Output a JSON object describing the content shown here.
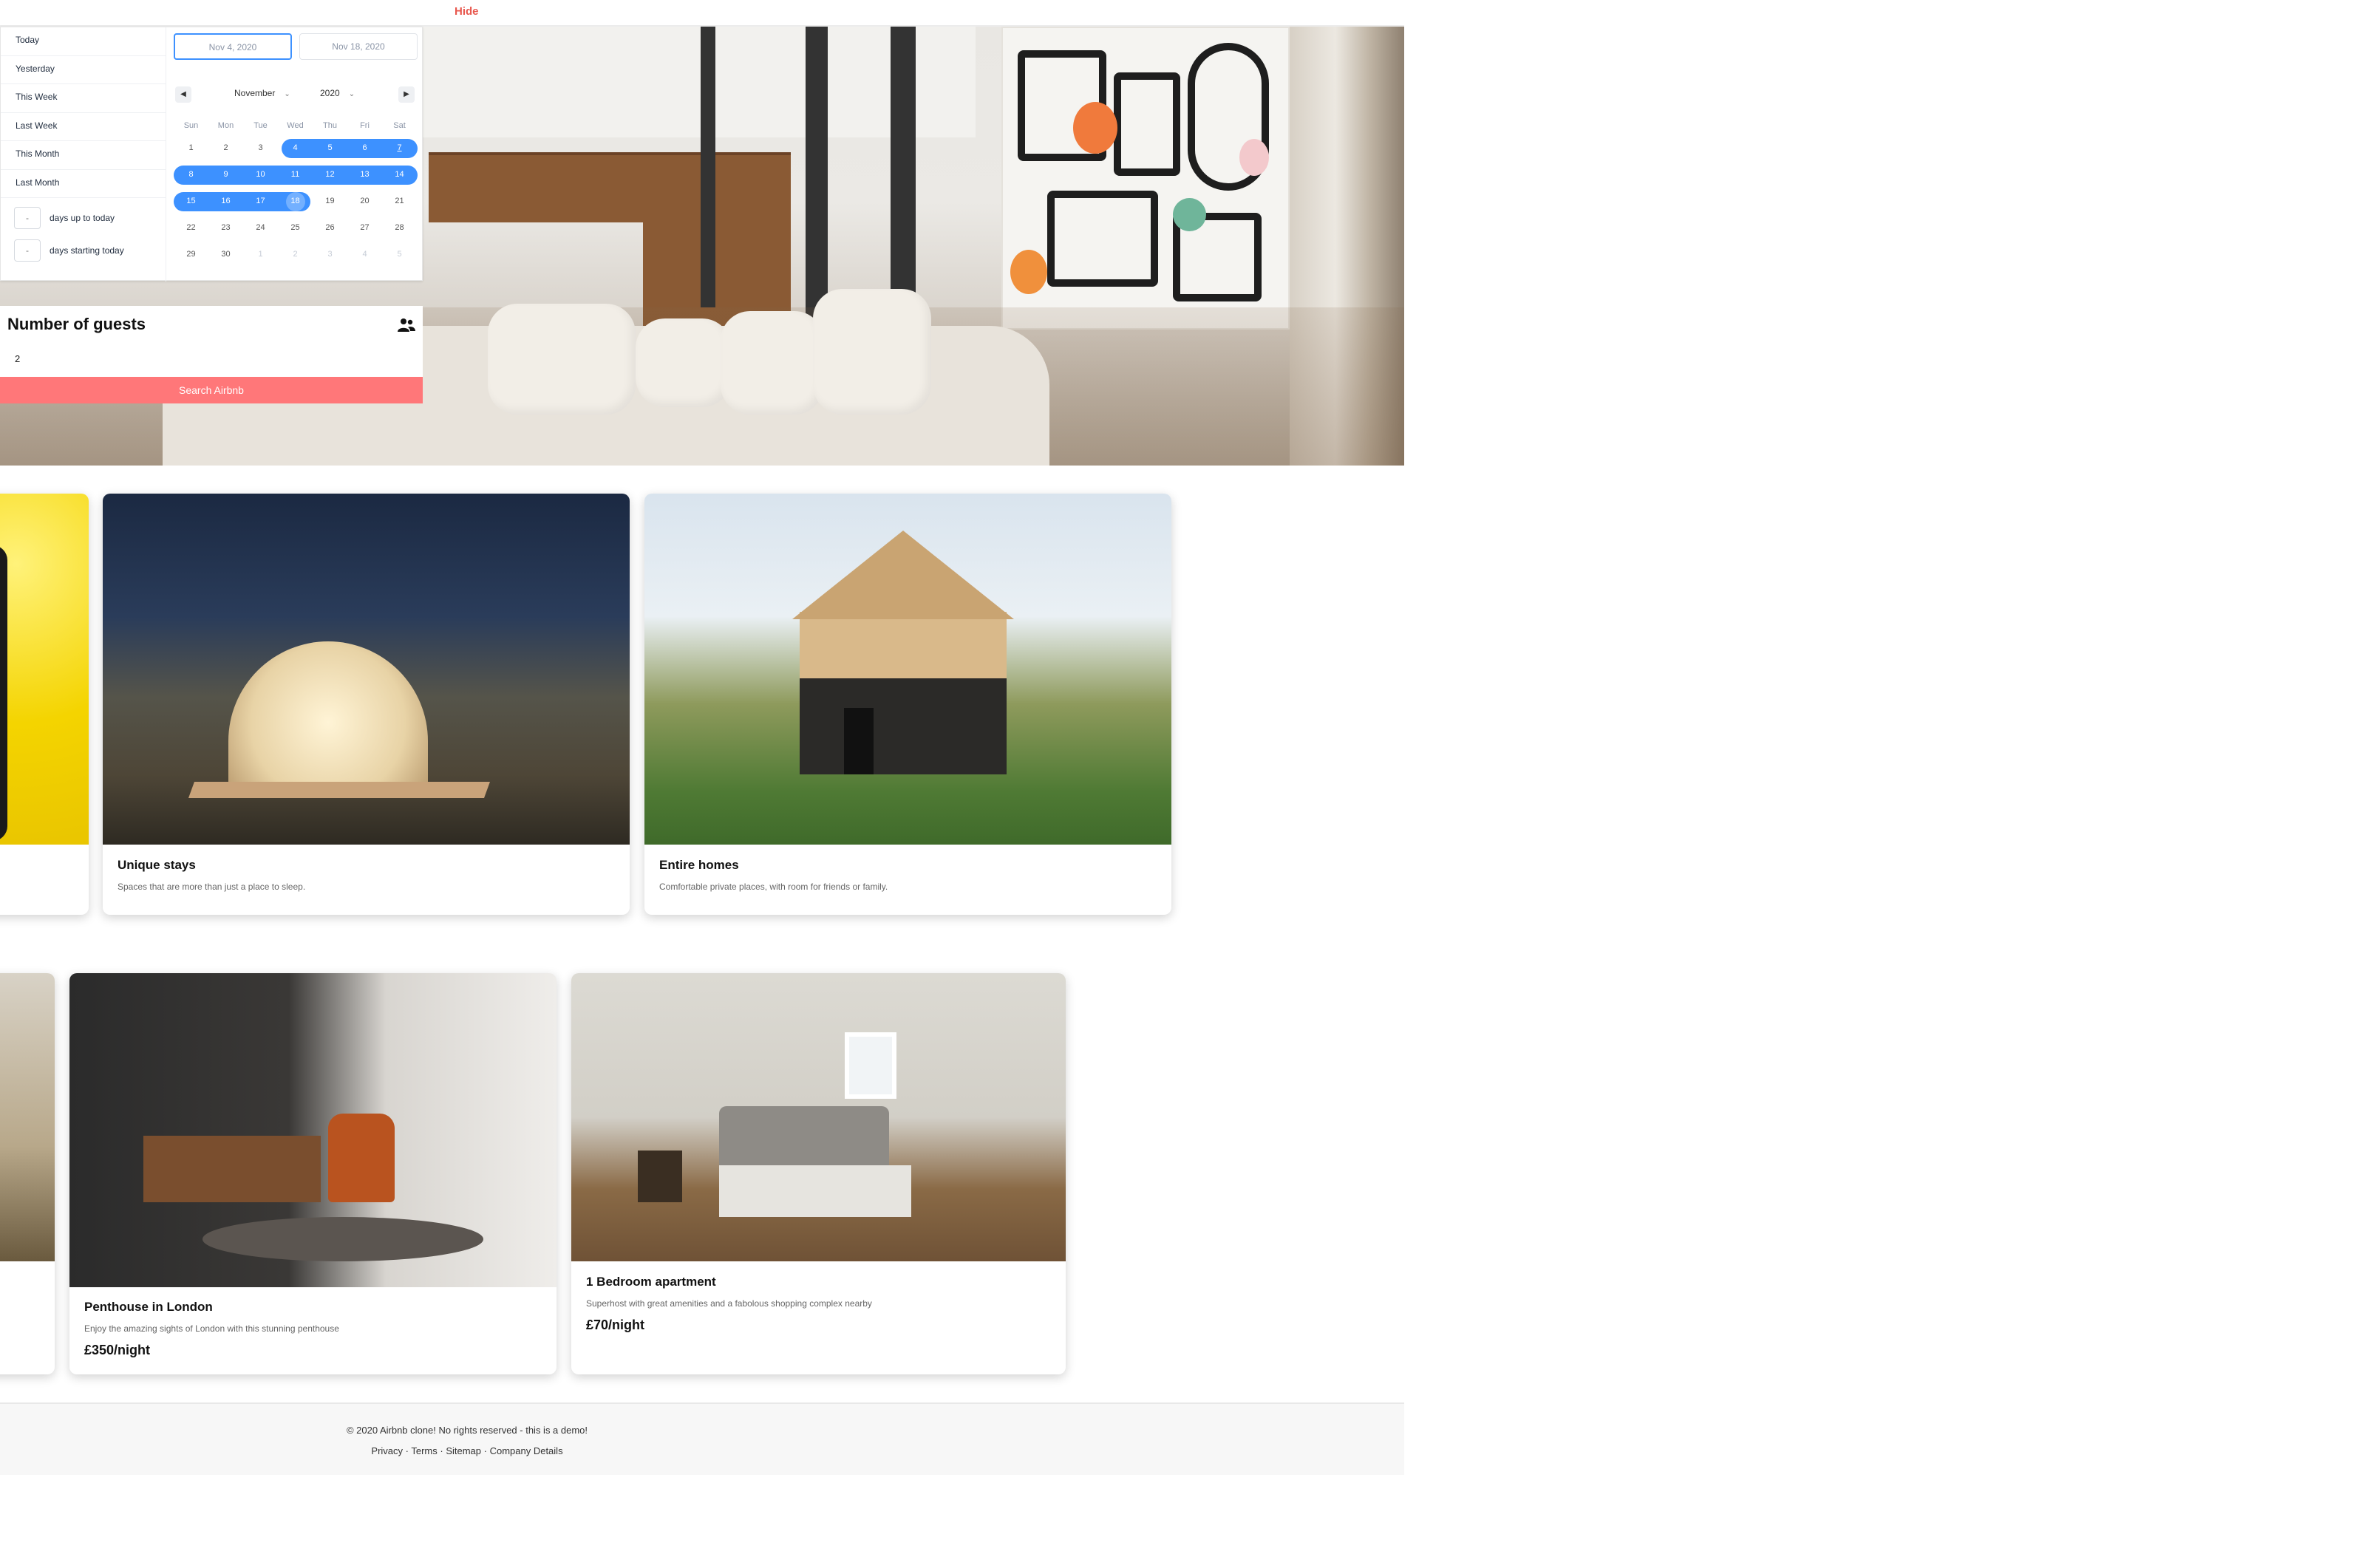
{
  "header": {
    "hide_label": "Hide"
  },
  "date_picker": {
    "ranges": [
      "Today",
      "Yesterday",
      "This Week",
      "Last Week",
      "This Month",
      "Last Month"
    ],
    "days_up_to_today": {
      "value": "-",
      "label": "days up to today"
    },
    "days_starting_today": {
      "value": "-",
      "label": "days starting today"
    },
    "start_date": "Nov 4, 2020",
    "end_date": "Nov 18, 2020",
    "month": "November",
    "year": "2020",
    "prev_icon": "triangle-left",
    "next_icon": "triangle-right",
    "weekdays": [
      "Sun",
      "Mon",
      "Tue",
      "Wed",
      "Thu",
      "Fri",
      "Sat"
    ],
    "weeks": [
      [
        "1",
        "2",
        "3",
        "4",
        "5",
        "6",
        "7"
      ],
      [
        "8",
        "9",
        "10",
        "11",
        "12",
        "13",
        "14"
      ],
      [
        "15",
        "16",
        "17",
        "18",
        "19",
        "20",
        "21"
      ],
      [
        "22",
        "23",
        "24",
        "25",
        "26",
        "27",
        "28"
      ],
      [
        "29",
        "30",
        "1",
        "2",
        "3",
        "4",
        "5"
      ]
    ],
    "accent_color": "#3d91ff"
  },
  "guests": {
    "title": "Number of guests",
    "value": "2",
    "icon": "people-icon"
  },
  "search": {
    "label": "Search Airbnb",
    "color": "#ff7779"
  },
  "categories": [
    {
      "title": "Unique stays",
      "description": "Spaces that are more than just a place to sleep."
    },
    {
      "title": "Entire homes",
      "description": "Comfortable private places, with room for friends or family."
    }
  ],
  "listings": [
    {
      "title": "Penthouse in London",
      "description": "Enjoy the amazing sights of London with this stunning penthouse",
      "price": "£350/night"
    },
    {
      "title": "1 Bedroom apartment",
      "description": "Superhost with great amenities and a fabolous shopping complex nearby",
      "price": "£70/night"
    }
  ],
  "footer": {
    "copyright": "© 2020 Airbnb clone! No rights reserved - this is a demo!",
    "links": [
      "Privacy",
      "Terms",
      "Sitemap",
      "Company Details"
    ],
    "separator": " · "
  }
}
